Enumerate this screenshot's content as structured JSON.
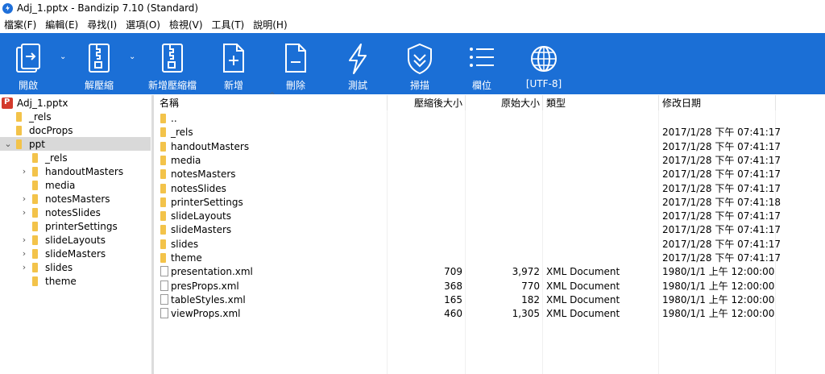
{
  "window": {
    "title": "Adj_1.pptx - Bandizip 7.10 (Standard)"
  },
  "menu": [
    "檔案(F)",
    "編輯(E)",
    "尋找(I)",
    "選項(O)",
    "檢視(V)",
    "工具(T)",
    "說明(H)"
  ],
  "toolbar": {
    "open": "開啟",
    "extract": "解壓縮",
    "new_archive": "新增壓縮檔",
    "add": "新增",
    "delete": "刪除",
    "test": "測試",
    "scan": "掃描",
    "columns": "欄位",
    "encoding": "[UTF-8]"
  },
  "tree": {
    "root": "Adj_1.pptx",
    "items": [
      {
        "label": "_rels",
        "depth": 1,
        "expandable": false,
        "selected": false
      },
      {
        "label": "docProps",
        "depth": 1,
        "expandable": false,
        "selected": false
      },
      {
        "label": "ppt",
        "depth": 1,
        "expandable": true,
        "expanded": true,
        "selected": true
      },
      {
        "label": "_rels",
        "depth": 2,
        "expandable": false,
        "selected": false
      },
      {
        "label": "handoutMasters",
        "depth": 2,
        "expandable": true,
        "selected": false
      },
      {
        "label": "media",
        "depth": 2,
        "expandable": false,
        "selected": false
      },
      {
        "label": "notesMasters",
        "depth": 2,
        "expandable": true,
        "selected": false
      },
      {
        "label": "notesSlides",
        "depth": 2,
        "expandable": true,
        "selected": false
      },
      {
        "label": "printerSettings",
        "depth": 2,
        "expandable": false,
        "selected": false
      },
      {
        "label": "slideLayouts",
        "depth": 2,
        "expandable": true,
        "selected": false
      },
      {
        "label": "slideMasters",
        "depth": 2,
        "expandable": true,
        "selected": false
      },
      {
        "label": "slides",
        "depth": 2,
        "expandable": true,
        "selected": false
      },
      {
        "label": "theme",
        "depth": 2,
        "expandable": false,
        "selected": false
      }
    ]
  },
  "columns": {
    "name": "名稱",
    "packed": "壓縮後大小",
    "size": "原始大小",
    "type": "類型",
    "modified": "修改日期"
  },
  "files": [
    {
      "name": "..",
      "kind": "folder",
      "packed": "",
      "size": "",
      "type": "",
      "modified": ""
    },
    {
      "name": "_rels",
      "kind": "folder",
      "packed": "",
      "size": "",
      "type": "",
      "modified": "2017/1/28 下午 07:41:17"
    },
    {
      "name": "handoutMasters",
      "kind": "folder",
      "packed": "",
      "size": "",
      "type": "",
      "modified": "2017/1/28 下午 07:41:17"
    },
    {
      "name": "media",
      "kind": "folder",
      "packed": "",
      "size": "",
      "type": "",
      "modified": "2017/1/28 下午 07:41:17"
    },
    {
      "name": "notesMasters",
      "kind": "folder",
      "packed": "",
      "size": "",
      "type": "",
      "modified": "2017/1/28 下午 07:41:17"
    },
    {
      "name": "notesSlides",
      "kind": "folder",
      "packed": "",
      "size": "",
      "type": "",
      "modified": "2017/1/28 下午 07:41:17"
    },
    {
      "name": "printerSettings",
      "kind": "folder",
      "packed": "",
      "size": "",
      "type": "",
      "modified": "2017/1/28 下午 07:41:18"
    },
    {
      "name": "slideLayouts",
      "kind": "folder",
      "packed": "",
      "size": "",
      "type": "",
      "modified": "2017/1/28 下午 07:41:17"
    },
    {
      "name": "slideMasters",
      "kind": "folder",
      "packed": "",
      "size": "",
      "type": "",
      "modified": "2017/1/28 下午 07:41:17"
    },
    {
      "name": "slides",
      "kind": "folder",
      "packed": "",
      "size": "",
      "type": "",
      "modified": "2017/1/28 下午 07:41:17"
    },
    {
      "name": "theme",
      "kind": "folder",
      "packed": "",
      "size": "",
      "type": "",
      "modified": "2017/1/28 下午 07:41:17"
    },
    {
      "name": "presentation.xml",
      "kind": "file",
      "packed": "709",
      "size": "3,972",
      "type": "XML Document",
      "modified": "1980/1/1 上午 12:00:00"
    },
    {
      "name": "presProps.xml",
      "kind": "file",
      "packed": "368",
      "size": "770",
      "type": "XML Document",
      "modified": "1980/1/1 上午 12:00:00"
    },
    {
      "name": "tableStyles.xml",
      "kind": "file",
      "packed": "165",
      "size": "182",
      "type": "XML Document",
      "modified": "1980/1/1 上午 12:00:00"
    },
    {
      "name": "viewProps.xml",
      "kind": "file",
      "packed": "460",
      "size": "1,305",
      "type": "XML Document",
      "modified": "1980/1/1 上午 12:00:00"
    }
  ],
  "colors": {
    "toolbar": "#1b6fd6",
    "folder": "#f3c34a",
    "selection": "#d9d9d9"
  },
  "icons": {
    "app": "bandizip-icon",
    "open": "open-icon",
    "extract": "extract-icon",
    "new_archive": "new-archive-icon",
    "add": "add-file-icon",
    "delete": "delete-file-icon",
    "test": "test-icon",
    "scan": "scan-shield-icon",
    "columns": "columns-icon",
    "encoding": "globe-icon"
  }
}
